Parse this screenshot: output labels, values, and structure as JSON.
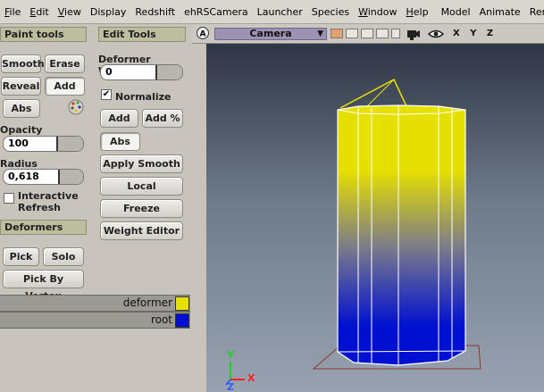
{
  "menubar": {
    "items": [
      {
        "label": "File",
        "u": "F",
        "rest": "ile"
      },
      {
        "label": "Edit",
        "u": "E",
        "rest": "dit"
      },
      {
        "label": "View",
        "u": "V",
        "rest": "iew"
      },
      {
        "label": "Display",
        "u": "",
        "rest": "Display"
      },
      {
        "label": "Redshift",
        "u": "",
        "rest": "Redshift"
      },
      {
        "label": "ehRSCamera",
        "u": "",
        "rest": "ehRSCamera"
      },
      {
        "label": "Launcher",
        "u": "",
        "rest": "Launcher"
      },
      {
        "label": "Species",
        "u": "",
        "rest": "Species"
      },
      {
        "label": "Window",
        "u": "W",
        "rest": "indow"
      },
      {
        "label": "Help",
        "u": "H",
        "rest": "elp"
      }
    ],
    "shelf": [
      "Model",
      "Animate",
      "Rende"
    ]
  },
  "paint_tools": {
    "header": "Paint tools",
    "smooth": "Smooth",
    "erase": "Erase",
    "reveal": "Reveal",
    "add": "Add",
    "abs": "Abs",
    "opacity_label": "Opacity",
    "opacity_value": "100",
    "radius_label": "Radius",
    "radius_value": "0,618",
    "interactive_refresh": "Interactive Refresh"
  },
  "edit_tools": {
    "header": "Edit Tools",
    "deformer_weight_label": "Deformer Weight",
    "deformer_weight_value": "0",
    "normalize": "Normalize",
    "add": "Add",
    "add_pct": "Add %",
    "abs": "Abs",
    "apply_smooth": "Apply Smooth",
    "local_reassign": "Local Reassign",
    "freeze": "Freeze",
    "weight_editor": "Weight Editor"
  },
  "deformers": {
    "header": "Deformers",
    "pick": "Pick",
    "solo": "Solo",
    "pick_by_vertex": "Pick By Vertex",
    "list": [
      {
        "name": "deformer",
        "color": "#e6e000"
      },
      {
        "name": "root",
        "color": "#0010d0"
      }
    ]
  },
  "viewport": {
    "camera": "Camera",
    "axes": "X Y Z",
    "axis_colors": {
      "x": "#ff2020",
      "y": "#20d020",
      "z": "#3060ff"
    },
    "gradient_top": "#e6e000",
    "gradient_bottom": "#0010d0"
  }
}
